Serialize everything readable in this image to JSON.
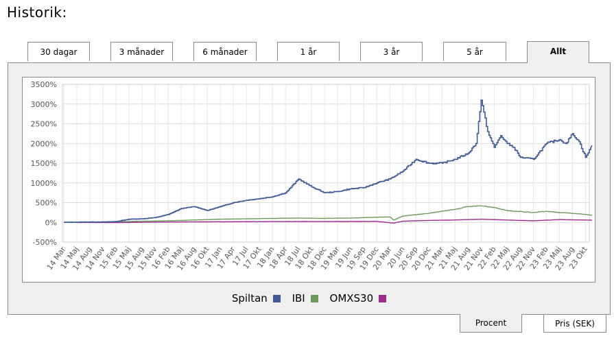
{
  "heading": "Historik:",
  "tabs": [
    {
      "label": "30 dagar",
      "active": false
    },
    {
      "label": "3 månader",
      "active": false
    },
    {
      "label": "6 månader",
      "active": false
    },
    {
      "label": "1 år",
      "active": false
    },
    {
      "label": "3 år",
      "active": false
    },
    {
      "label": "5 år",
      "active": false
    },
    {
      "label": "Allt",
      "active": true
    }
  ],
  "bottom_tabs": [
    {
      "label": "Procent",
      "active": true
    },
    {
      "label": "Pris (SEK)",
      "active": false
    }
  ],
  "chart_data": {
    "type": "line",
    "title": "",
    "xlabel": "",
    "ylabel": "",
    "ylim": [
      -500,
      3500
    ],
    "yticks": [
      -500,
      0,
      500,
      1000,
      1500,
      2000,
      2500,
      3000,
      3500
    ],
    "ytick_labels": [
      "-500%",
      "0%",
      "500%",
      "1000%",
      "1500%",
      "2000%",
      "2500%",
      "3000%",
      "3500%"
    ],
    "xticks": [
      "14 Mar",
      "14 Maj",
      "14 Aug",
      "14 Nov",
      "15 Feb",
      "15 Maj",
      "15 Aug",
      "15 Nov",
      "16 Feb",
      "16 Maj",
      "16 Aug",
      "16 Okt",
      "17 Jan",
      "17 Apr",
      "17 Jul",
      "17 Okt",
      "18 Jan",
      "18 Apr",
      "18 Jul",
      "18 Okt",
      "18 Dec",
      "19 Mar",
      "19 Jun",
      "19 Sep",
      "19 Dec",
      "20 Mar",
      "20 Jun",
      "20 Sep",
      "20 Dec",
      "21 Mar",
      "21 Maj",
      "21 Aug",
      "21 Nov",
      "22 Feb",
      "22 Maj",
      "22 Aug",
      "22 Nov",
      "23 Feb",
      "23 Maj",
      "23 Aug",
      "23 Okt"
    ],
    "grid": true,
    "legend_position": "bottom",
    "series": [
      {
        "name": "Spiltan",
        "color": "#3b5998",
        "values": [
          [
            0,
            0
          ],
          [
            1,
            5
          ],
          [
            2,
            10
          ],
          [
            3,
            8
          ],
          [
            4,
            20
          ],
          [
            5,
            80
          ],
          [
            6,
            90
          ],
          [
            7,
            120
          ],
          [
            8,
            200
          ],
          [
            9,
            350
          ],
          [
            10,
            400
          ],
          [
            11,
            300
          ],
          [
            12,
            400
          ],
          [
            13,
            500
          ],
          [
            14,
            560
          ],
          [
            15,
            600
          ],
          [
            16,
            650
          ],
          [
            17,
            750
          ],
          [
            18,
            1100
          ],
          [
            19,
            900
          ],
          [
            20,
            750
          ],
          [
            21,
            780
          ],
          [
            22,
            850
          ],
          [
            23,
            880
          ],
          [
            24,
            1000
          ],
          [
            25,
            1100
          ],
          [
            26,
            1300
          ],
          [
            27,
            1600
          ],
          [
            28,
            1500
          ],
          [
            29,
            1500
          ],
          [
            30,
            1600
          ],
          [
            31,
            1750
          ],
          [
            31.6,
            2000
          ],
          [
            32,
            3100
          ],
          [
            32.5,
            2300
          ],
          [
            33,
            1900
          ],
          [
            33.5,
            2200
          ],
          [
            34,
            2000
          ],
          [
            34.5,
            1900
          ],
          [
            35,
            1650
          ],
          [
            36,
            1600
          ],
          [
            37,
            2000
          ],
          [
            38,
            2100
          ],
          [
            38.5,
            2000
          ],
          [
            39,
            2250
          ],
          [
            39.5,
            2050
          ],
          [
            40,
            1650
          ],
          [
            40.5,
            1950
          ]
        ]
      },
      {
        "name": "IBI",
        "color": "#6a9a5a",
        "values": [
          [
            0,
            0
          ],
          [
            2,
            5
          ],
          [
            4,
            15
          ],
          [
            6,
            30
          ],
          [
            8,
            40
          ],
          [
            10,
            60
          ],
          [
            12,
            80
          ],
          [
            14,
            90
          ],
          [
            16,
            100
          ],
          [
            18,
            110
          ],
          [
            20,
            100
          ],
          [
            22,
            110
          ],
          [
            24,
            130
          ],
          [
            25,
            140
          ],
          [
            25.3,
            60
          ],
          [
            26,
            160
          ],
          [
            28,
            230
          ],
          [
            30,
            330
          ],
          [
            31,
            400
          ],
          [
            32,
            420
          ],
          [
            33,
            380
          ],
          [
            34,
            300
          ],
          [
            36,
            250
          ],
          [
            37,
            280
          ],
          [
            38,
            250
          ],
          [
            39,
            230
          ],
          [
            40,
            200
          ],
          [
            40.5,
            180
          ]
        ]
      },
      {
        "name": "OMXS30",
        "color": "#a0288e",
        "values": [
          [
            0,
            0
          ],
          [
            4,
            -5
          ],
          [
            8,
            10
          ],
          [
            12,
            15
          ],
          [
            16,
            20
          ],
          [
            20,
            20
          ],
          [
            24,
            25
          ],
          [
            25.3,
            -20
          ],
          [
            26,
            30
          ],
          [
            28,
            50
          ],
          [
            30,
            60
          ],
          [
            32,
            80
          ],
          [
            34,
            60
          ],
          [
            36,
            40
          ],
          [
            38,
            70
          ],
          [
            40,
            60
          ],
          [
            40.5,
            55
          ]
        ]
      }
    ]
  }
}
